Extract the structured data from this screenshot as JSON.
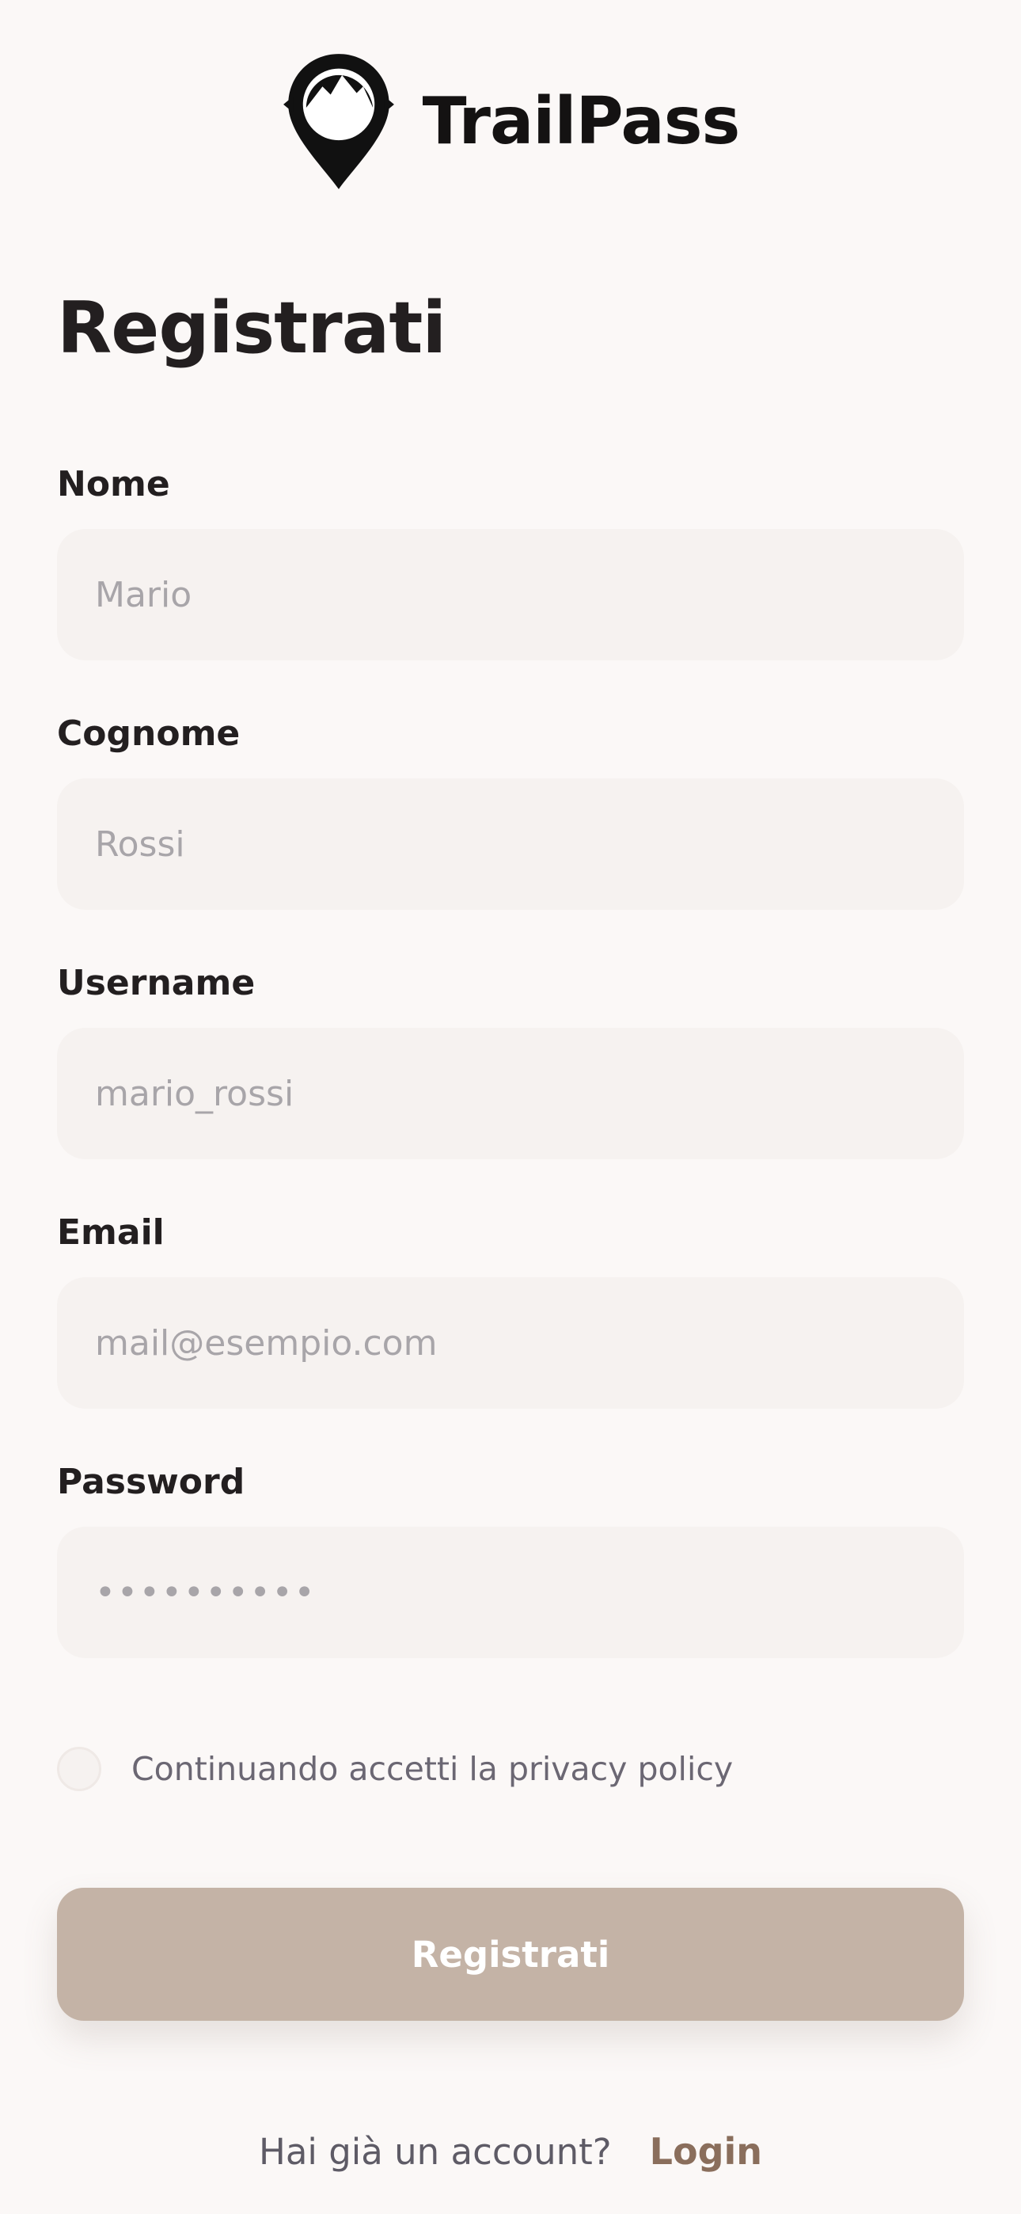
{
  "brand": {
    "name": "TrailPass",
    "logo_icon": "map-pin-mountain-icon"
  },
  "page": {
    "title": "Registrati"
  },
  "form": {
    "nome": {
      "label": "Nome",
      "placeholder": "Mario"
    },
    "cognome": {
      "label": "Cognome",
      "placeholder": "Rossi"
    },
    "username": {
      "label": "Username",
      "placeholder": "mario_rossi"
    },
    "email": {
      "label": "Email",
      "placeholder": "mail@esempio.com"
    },
    "password": {
      "label": "Password",
      "placeholder": "••••••••••"
    }
  },
  "privacy": {
    "label": "Continuando accetti la privacy policy",
    "checked": false
  },
  "submit": {
    "label": "Registrati"
  },
  "footer": {
    "question": "Hai già un account?",
    "login_label": "Login"
  },
  "colors": {
    "background": "#FBF8F7",
    "input_background": "#F6F2F0",
    "button": "#C4B3A6",
    "link": "#8A6E5C",
    "text": "#231F20"
  }
}
